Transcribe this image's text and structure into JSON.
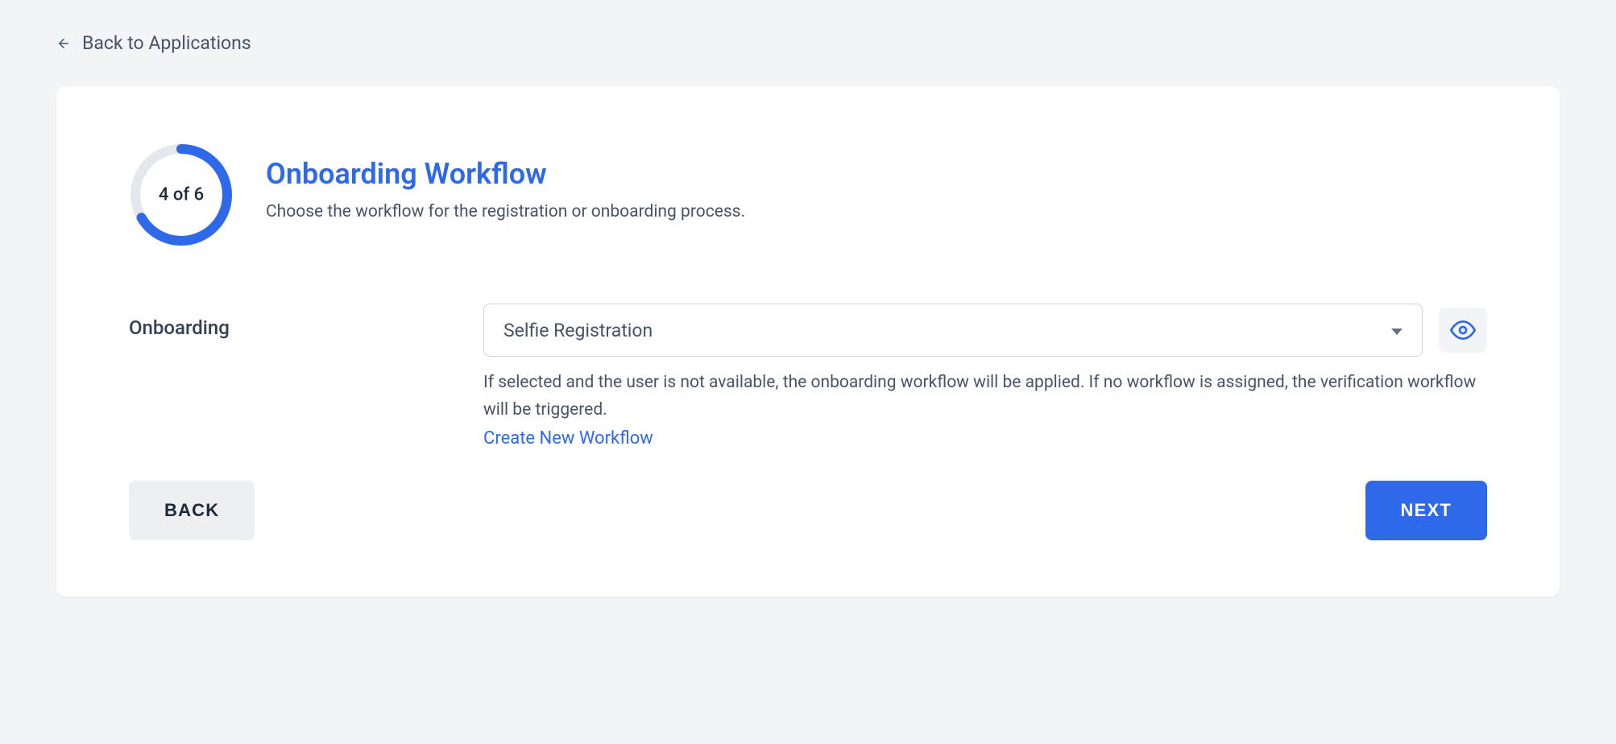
{
  "nav": {
    "back_label": "Back to Applications"
  },
  "progress": {
    "current": 4,
    "total": 6,
    "label": "4 of 6"
  },
  "header": {
    "title": "Onboarding Workflow",
    "subtitle": "Choose the workflow for the registration or onboarding process."
  },
  "form": {
    "onboarding": {
      "label": "Onboarding",
      "selected_value": "Selfie Registration",
      "help_text": "If selected and the user is not available, the onboarding workflow will be applied. If no workflow is assigned, the verification workflow will be triggered.",
      "create_link_label": "Create New Workflow"
    }
  },
  "footer": {
    "back_label": "BACK",
    "next_label": "NEXT"
  },
  "colors": {
    "accent": "#2e69ea",
    "text_primary": "#1d2939",
    "text_secondary": "#475467",
    "border": "#d0d5dd",
    "bg_page": "#f2f4f7"
  }
}
